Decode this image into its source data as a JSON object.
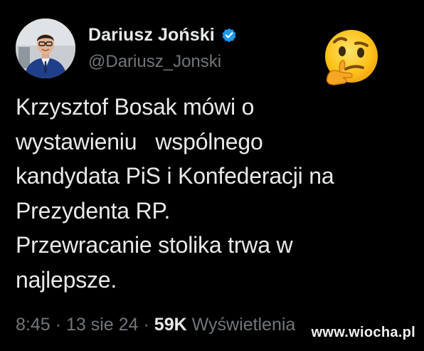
{
  "author": {
    "display_name": "Dariusz Joński",
    "handle": "@Dariusz_Jonski",
    "verified": true
  },
  "reaction_emoji": "thinking-face-emoji",
  "tweet": {
    "lines": [
      "Krzysztof Bosak mówi o",
      "wystawieniu   wspólnego",
      "kandydata PiS i Konfederacji na",
      "Prezydenta RP.",
      "Przewracanie stolika trwa w",
      "najlepsze."
    ]
  },
  "meta": {
    "time": "8:45",
    "separator": "·",
    "date": "13 sie 24",
    "views_count": "59K",
    "views_label": "Wyświetlenia"
  },
  "watermark": "www.wiocha.pl",
  "colors": {
    "background": "#000000",
    "primary_text": "#e7e9ea",
    "secondary_text": "#71767b",
    "verified_badge": "#1d9bf0"
  }
}
